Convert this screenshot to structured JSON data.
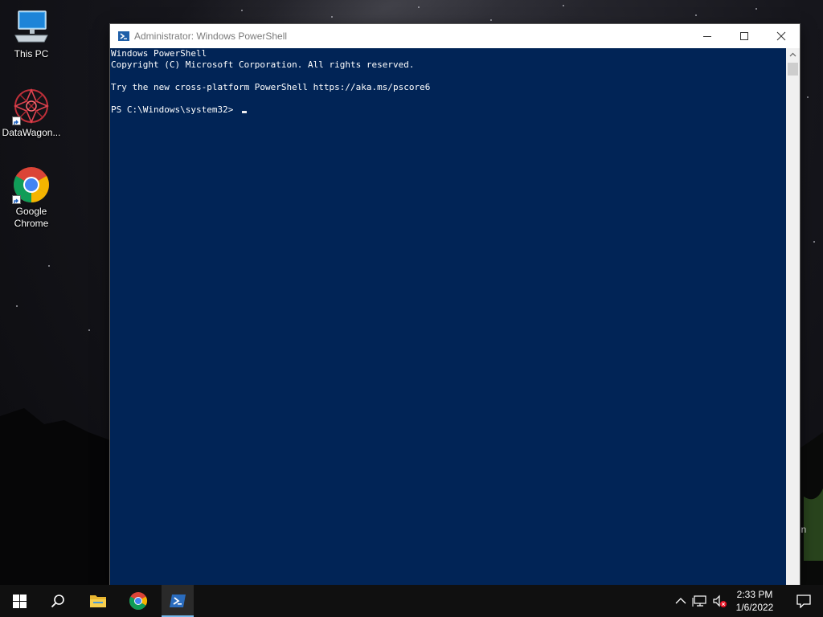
{
  "desktop": {
    "icons": [
      {
        "label": "This PC"
      },
      {
        "label": "DataWagon..."
      },
      {
        "label_line1": "Google",
        "label_line2": "Chrome"
      }
    ],
    "watermark_fragment": "in"
  },
  "window": {
    "title": "Administrator: Windows PowerShell",
    "console_lines": [
      "Windows PowerShell",
      "Copyright (C) Microsoft Corporation. All rights reserved.",
      "",
      "Try the new cross-platform PowerShell https://aka.ms/pscore6",
      "",
      "PS C:\\Windows\\system32> "
    ],
    "console_background": "#012456",
    "console_foreground": "#ffffff"
  },
  "taskbar": {
    "buttons": [
      "start-icon",
      "search-icon",
      "file-explorer-icon",
      "chrome-icon",
      "powershell-icon"
    ],
    "active": "powershell-icon",
    "tray_icons": [
      "chevron-up-icon",
      "network-icon",
      "volume-muted-icon"
    ],
    "time": "2:33 PM",
    "date": "1/6/2022",
    "accent_color": "#76b9ed"
  }
}
